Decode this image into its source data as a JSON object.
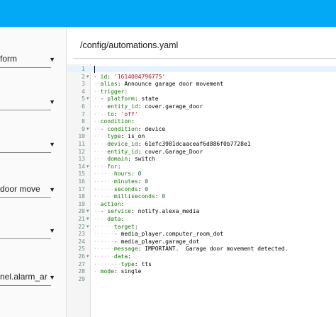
{
  "sidebar": {
    "selects": [
      {
        "text": "form"
      },
      {
        "text": ""
      },
      {
        "text": ""
      },
      {
        "text": "door move"
      },
      {
        "text": ""
      },
      {
        "text": "nel.alarm_ar"
      }
    ]
  },
  "editor": {
    "path": "/config/automations.yaml",
    "lines": [
      {
        "num": "1",
        "fold": false,
        "indent": "",
        "dash": "",
        "key": "",
        "colon": "",
        "value": "",
        "vtype": ""
      },
      {
        "num": "2",
        "fold": true,
        "indent": "",
        "dash": "- ",
        "key": "id",
        "colon": ": ",
        "value": "'1614004796775'",
        "vtype": "str"
      },
      {
        "num": "3",
        "fold": false,
        "indent": "··",
        "dash": "",
        "key": "alias",
        "colon": ": ",
        "value": "Announce garage door movement",
        "vtype": "val"
      },
      {
        "num": "4",
        "fold": false,
        "indent": "··",
        "dash": "",
        "key": "trigger",
        "colon": ":",
        "value": "",
        "vtype": ""
      },
      {
        "num": "5",
        "fold": true,
        "indent": "··",
        "dash": "- ",
        "key": "platform",
        "colon": ": ",
        "value": "state",
        "vtype": "val"
      },
      {
        "num": "6",
        "fold": false,
        "indent": "····",
        "dash": "",
        "key": "entity_id",
        "colon": ": ",
        "value": "cover.garage_door",
        "vtype": "val"
      },
      {
        "num": "7",
        "fold": false,
        "indent": "····",
        "dash": "",
        "key": "to",
        "colon": ": ",
        "value": "'off'",
        "vtype": "str"
      },
      {
        "num": "8",
        "fold": false,
        "indent": "··",
        "dash": "",
        "key": "condition",
        "colon": ":",
        "value": "",
        "vtype": ""
      },
      {
        "num": "9",
        "fold": true,
        "indent": "··",
        "dash": "- ",
        "key": "condition",
        "colon": ": ",
        "value": "device",
        "vtype": "val"
      },
      {
        "num": "10",
        "fold": false,
        "indent": "····",
        "dash": "",
        "key": "type",
        "colon": ": ",
        "value": "is_on",
        "vtype": "val"
      },
      {
        "num": "11",
        "fold": false,
        "indent": "····",
        "dash": "",
        "key": "device_id",
        "colon": ": ",
        "value": "61efc3981dcaaceaf6d886f0b7728e1",
        "vtype": "val"
      },
      {
        "num": "12",
        "fold": false,
        "indent": "····",
        "dash": "",
        "key": "entity_id",
        "colon": ": ",
        "value": "cover.Garage_Door",
        "vtype": "val"
      },
      {
        "num": "13",
        "fold": false,
        "indent": "····",
        "dash": "",
        "key": "domain",
        "colon": ": ",
        "value": "switch",
        "vtype": "val"
      },
      {
        "num": "14",
        "fold": true,
        "indent": "····",
        "dash": "",
        "key": "for",
        "colon": ":",
        "value": "",
        "vtype": ""
      },
      {
        "num": "15",
        "fold": false,
        "indent": "······",
        "dash": "",
        "key": "hours",
        "colon": ": ",
        "value": "0",
        "vtype": "num"
      },
      {
        "num": "16",
        "fold": false,
        "indent": "······",
        "dash": "",
        "key": "minutes",
        "colon": ": ",
        "value": "0",
        "vtype": "num"
      },
      {
        "num": "17",
        "fold": false,
        "indent": "······",
        "dash": "",
        "key": "seconds",
        "colon": ": ",
        "value": "0",
        "vtype": "num"
      },
      {
        "num": "18",
        "fold": false,
        "indent": "······",
        "dash": "",
        "key": "milliseconds",
        "colon": ": ",
        "value": "0",
        "vtype": "num"
      },
      {
        "num": "19",
        "fold": false,
        "indent": "··",
        "dash": "",
        "key": "action",
        "colon": ":",
        "value": "",
        "vtype": ""
      },
      {
        "num": "20",
        "fold": true,
        "indent": "··",
        "dash": "- ",
        "key": "service",
        "colon": ": ",
        "value": "notify.alexa_media",
        "vtype": "val"
      },
      {
        "num": "21",
        "fold": true,
        "indent": "····",
        "dash": "",
        "key": "data",
        "colon": ":",
        "value": "",
        "vtype": ""
      },
      {
        "num": "22",
        "fold": true,
        "indent": "······",
        "dash": "",
        "key": "target",
        "colon": ":",
        "value": "",
        "vtype": ""
      },
      {
        "num": "23",
        "fold": false,
        "indent": "······",
        "dash": "- ",
        "key": "",
        "colon": "",
        "value": "media_player.computer_room_dot",
        "vtype": "val"
      },
      {
        "num": "24",
        "fold": false,
        "indent": "······",
        "dash": "- ",
        "key": "",
        "colon": "",
        "value": "media_player.garage_dot",
        "vtype": "val"
      },
      {
        "num": "25",
        "fold": false,
        "indent": "······",
        "dash": "",
        "key": "message",
        "colon": ": ",
        "value": "IMPORTANT.  Garage door movement detected.",
        "vtype": "val"
      },
      {
        "num": "26",
        "fold": true,
        "indent": "······",
        "dash": "",
        "key": "data",
        "colon": ":",
        "value": "",
        "vtype": ""
      },
      {
        "num": "27",
        "fold": false,
        "indent": "········",
        "dash": "",
        "key": "type",
        "colon": ": ",
        "value": "tts",
        "vtype": "val"
      },
      {
        "num": "28",
        "fold": false,
        "indent": "··",
        "dash": "",
        "key": "mode",
        "colon": ": ",
        "value": "single",
        "vtype": "val"
      },
      {
        "num": "29",
        "fold": false,
        "indent": "",
        "dash": "",
        "key": "",
        "colon": "",
        "value": "",
        "vtype": ""
      }
    ]
  },
  "colors": {
    "header": "#03a9f4",
    "key": "#117700",
    "string": "#aa1111",
    "number": "#116644",
    "dash": "#770088"
  },
  "icons": {
    "caret": "caret-down-icon",
    "fold": "fold-arrow-icon"
  }
}
